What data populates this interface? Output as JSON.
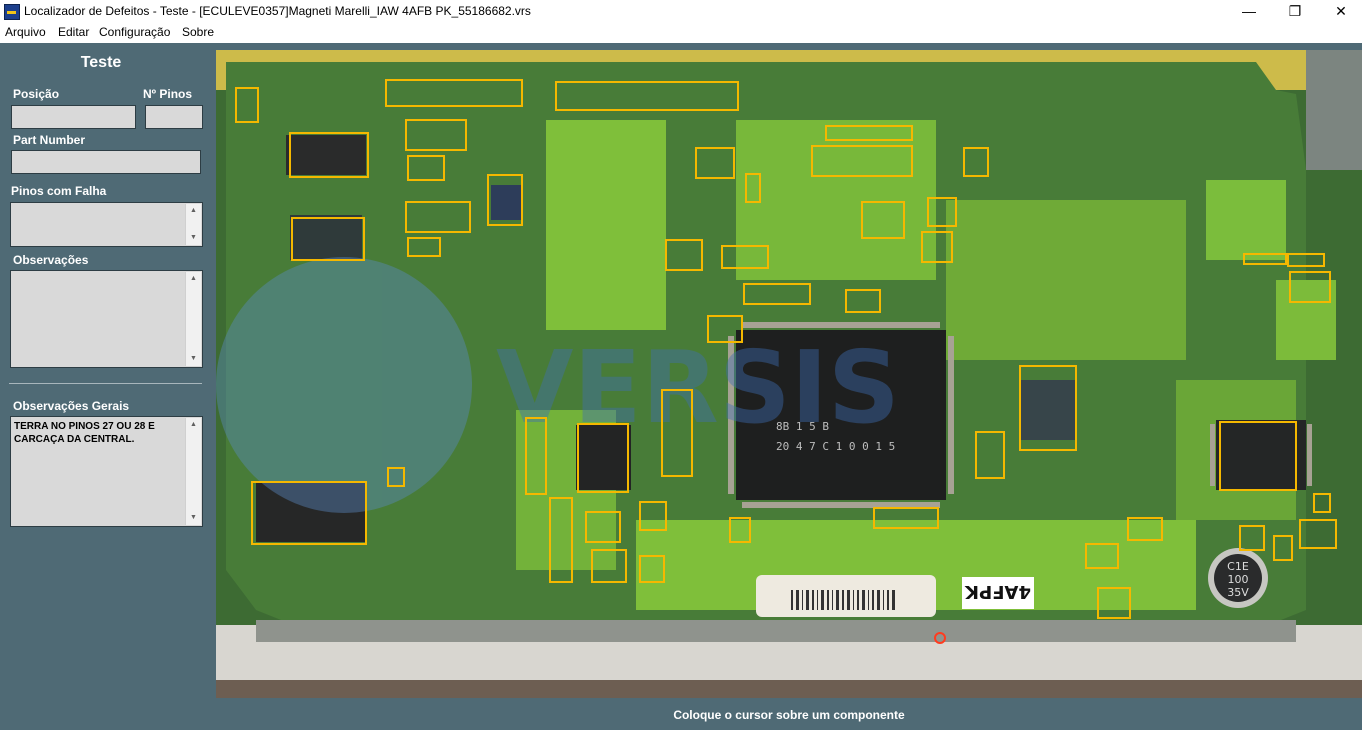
{
  "window": {
    "title": "Localizador de Defeitos - Teste - [ECULEVE0357]Magneti Marelli_IAW 4AFB PK_55186682.vrs",
    "controls": {
      "minimize": "—",
      "maximize": "❐",
      "close": "✕"
    }
  },
  "menu": {
    "items": [
      "Arquivo",
      "Editar",
      "Configuração",
      "Sobre"
    ]
  },
  "sidebar": {
    "heading": "Teste",
    "posicao_label": "Posição",
    "posicao_value": "",
    "npinos_label": "Nº Pinos",
    "npinos_value": "",
    "partnumber_label": "Part Number",
    "partnumber_value": "",
    "pinos_falha_label": "Pinos com Falha",
    "pinos_falha_value": "",
    "observacoes_label": "Observações",
    "observacoes_value": "",
    "obs_gerais_label": "Observações Gerais",
    "obs_gerais_value": "TERRA NO PINOS 27 OU 28 E CARCAÇA DA CENTRAL."
  },
  "board": {
    "chip_label_1": "8B 1 5 B",
    "chip_label_2": "20 4 7 C 1 0 0 1 5",
    "capacitor_label_1": "C1E",
    "capacitor_label_2": "100",
    "capacitor_label_3": "35V",
    "sticker_label": "4AFPK",
    "watermark": "VERSIS",
    "highlight_color": "#f5b800"
  },
  "status": {
    "text": "Coloque o cursor sobre um componente"
  }
}
